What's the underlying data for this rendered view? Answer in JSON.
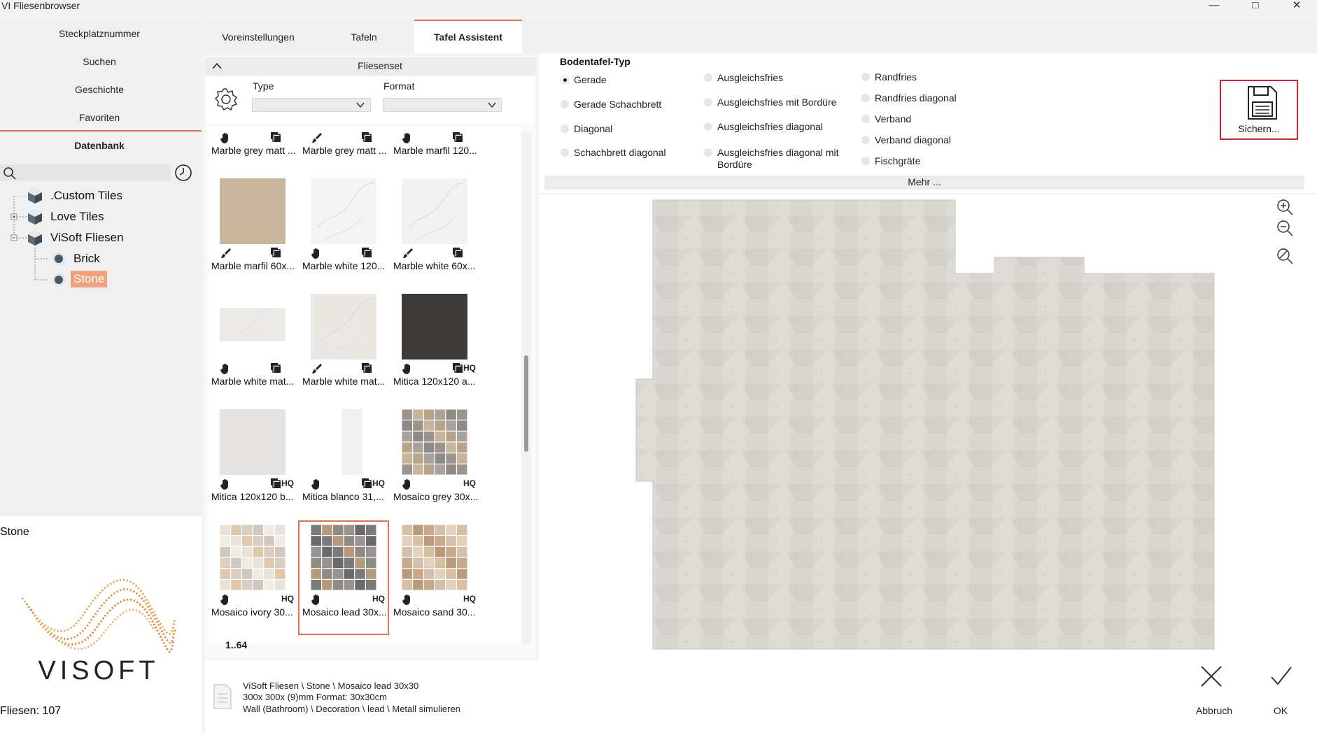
{
  "window": {
    "title": "Fliesenbrowser",
    "app_logo": "VI"
  },
  "left_nav": {
    "items": [
      "Steckplatznummer",
      "Suchen",
      "Geschichte",
      "Favoriten",
      "Datenbank"
    ],
    "search_placeholder": ""
  },
  "tree": {
    "items": [
      {
        "label": ".Custom Tiles"
      },
      {
        "label": "Love Tiles"
      },
      {
        "label": "ViSoft Fliesen"
      },
      {
        "label": "Brick"
      },
      {
        "label": "Stone",
        "selected": true
      }
    ]
  },
  "selection": {
    "name": "Stone",
    "logo_text": "VISOFT",
    "count_label": "Fliesen: 107"
  },
  "tabs": {
    "items": [
      "Voreinstellungen",
      "Tafeln",
      "Tafel Assistent"
    ],
    "active": "Tafel Assistent"
  },
  "fliesenset": {
    "title": "Fliesenset",
    "type_label": "Type",
    "format_label": "Format",
    "type_value": "",
    "format_value": "",
    "page_indicator": "1..64",
    "tiles": [
      {
        "name": "Marble grey matt ...",
        "icon": "hand-icon",
        "hq": false
      },
      {
        "name": "Marble grey matt ...",
        "icon": "brush-icon",
        "hq": false
      },
      {
        "name": "Marble marfil 120...",
        "icon": "hand-icon",
        "hq": false
      },
      {
        "name": "Marble marfil 60x...",
        "icon": "brush-icon",
        "hq": false
      },
      {
        "name": "Marble white 120...",
        "icon": "hand-icon",
        "hq": false
      },
      {
        "name": "Marble white 60x...",
        "icon": "brush-icon",
        "hq": false
      },
      {
        "name": "Marble white mat...",
        "icon": "hand-icon",
        "hq": false
      },
      {
        "name": "Marble white mat...",
        "icon": "brush-icon",
        "hq": false
      },
      {
        "name": "Mitica 120x120 a...",
        "icon": "hand-icon",
        "hq": true
      },
      {
        "name": "Mitica 120x120 b...",
        "icon": "hand-icon",
        "hq": true
      },
      {
        "name": "Mitica blanco 31,...",
        "icon": "hand-icon",
        "hq": true
      },
      {
        "name": "Mosaico grey 30x...",
        "icon": "hand-icon",
        "hq": true
      },
      {
        "name": "Mosaico ivory 30...",
        "icon": "hand-icon",
        "hq": true
      },
      {
        "name": "Mosaico  lead 30x...",
        "icon": "hand-icon",
        "hq": true,
        "selected": true
      },
      {
        "name": "Mosaico sand 30...",
        "icon": "hand-icon",
        "hq": true
      }
    ],
    "hq_label": "HQ"
  },
  "info": {
    "line1": "ViSoft Fliesen \\ Stone \\ Mosaico lead 30x30",
    "line2": "300x 300x (9)mm Format: 30x30cm",
    "line3": "Wall (Bathroom) \\ Decoration \\ lead \\ Metall simulieren"
  },
  "bodentafel": {
    "title": "Bodentafel-Typ",
    "selected": "Gerade",
    "col1": [
      "Gerade",
      "Gerade Schachbrett",
      "Diagonal",
      "Schachbrett diagonal"
    ],
    "col2": [
      "Ausgleichsfries",
      "Ausgleichsfries mit Bordüre",
      "Ausgleichsfries diagonal",
      "Ausgleichsfries diagonal mit",
      "Bordüre"
    ],
    "col3": [
      "Randfries",
      "Randfries diagonal",
      "Verband",
      "Verband diagonal",
      "Fischgräte"
    ],
    "more_label": "Mehr ..."
  },
  "save": {
    "label": "Sichern..."
  },
  "actions": {
    "cancel": "Abbruch",
    "ok": "OK"
  },
  "colors": {
    "accent": "#e0744b",
    "highlight_border": "#e02020",
    "selected_tree_bg": "#f4a07c"
  }
}
